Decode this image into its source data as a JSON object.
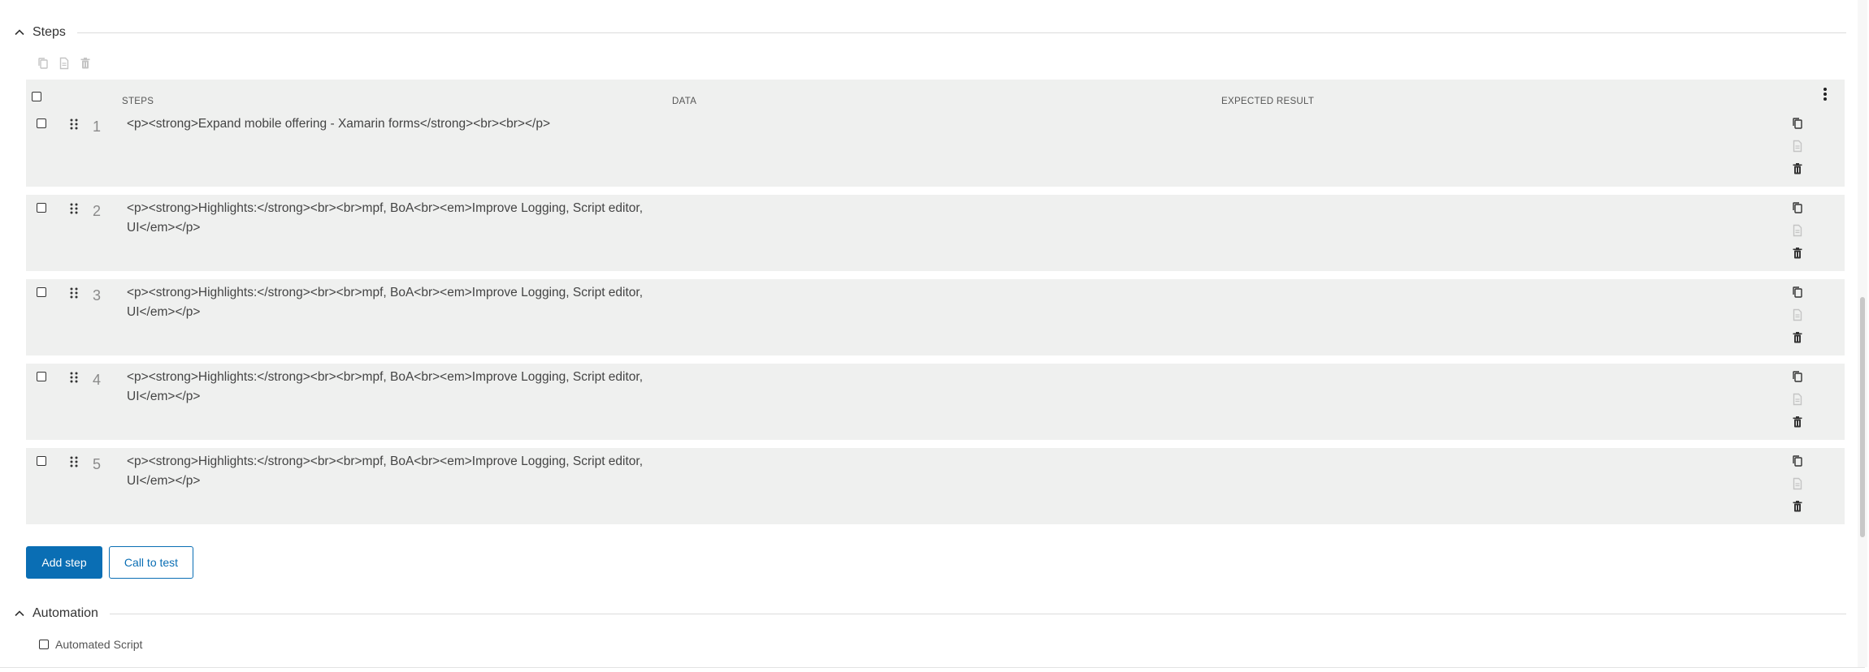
{
  "steps_section": {
    "title": "Steps"
  },
  "table": {
    "headers": {
      "steps": "STEPS",
      "data": "DATA",
      "expected": "EXPECTED RESULT"
    },
    "rows": [
      {
        "num": "1",
        "text": "<p><strong>Expand mobile offering - Xamarin forms</strong><br><br></p>"
      },
      {
        "num": "2",
        "text": "<p><strong>Highlights:</strong><br><br>mpf, BoA<br><em>Improve Logging, Script editor, UI</em></p>"
      },
      {
        "num": "3",
        "text": "<p><strong>Highlights:</strong><br><br>mpf, BoA<br><em>Improve Logging, Script editor, UI</em></p>"
      },
      {
        "num": "4",
        "text": "<p><strong>Highlights:</strong><br><br>mpf, BoA<br><em>Improve Logging, Script editor, UI</em></p>"
      },
      {
        "num": "5",
        "text": "<p><strong>Highlights:</strong><br><br>mpf, BoA<br><em>Improve Logging, Script editor, UI</em></p>"
      }
    ]
  },
  "buttons": {
    "add_step": "Add step",
    "call_to_test": "Call to test"
  },
  "automation_section": {
    "title": "Automation",
    "checkbox_label": "Automated Script"
  },
  "colors": {
    "primary": "#0a6eb4",
    "row_bg": "#eff0ef",
    "disabled_icon": "#c4c4c4"
  },
  "icons": {
    "toolbar": [
      "copy-icon",
      "file-icon",
      "trash-icon"
    ],
    "row_actions": [
      "copy-icon",
      "file-icon",
      "trash-icon"
    ],
    "header_menu": "kebab-menu-icon",
    "row_handle": "drag-handle-icon",
    "section_toggle": "chevron-up-icon"
  }
}
